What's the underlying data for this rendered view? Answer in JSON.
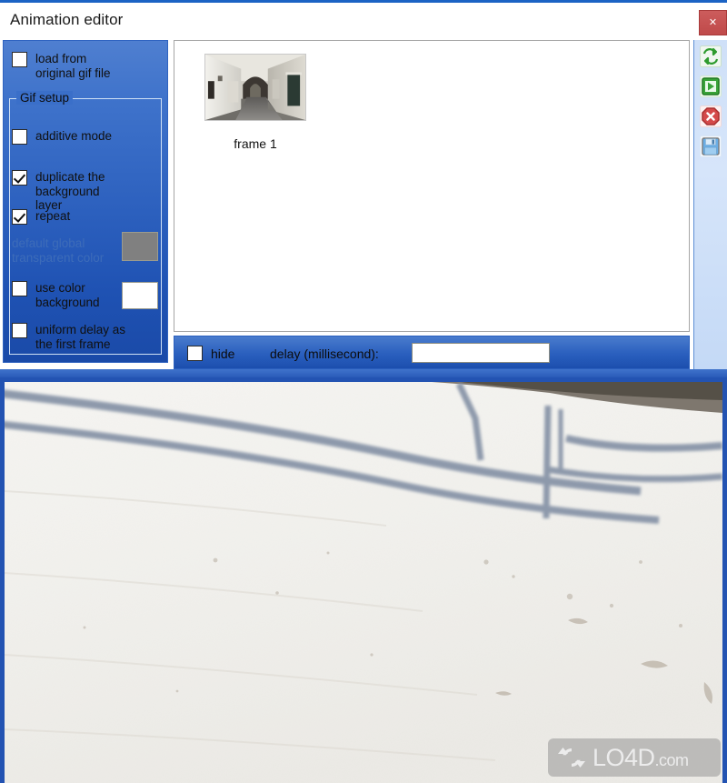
{
  "window": {
    "title": "Animation editor",
    "close_label": "✕"
  },
  "left_panel": {
    "load_from_original": {
      "label": "load from\noriginal gif file",
      "checked": false
    },
    "group": {
      "title": "Gif setup",
      "options": [
        {
          "name": "additive-mode",
          "label": "additive mode",
          "checked": false
        },
        {
          "name": "duplicate-background-layer",
          "label": "duplicate the\nbackground\nlayer",
          "checked": true
        },
        {
          "name": "repeat",
          "label": "repeat",
          "checked": true
        }
      ],
      "transparent_color": {
        "label": "default global\ntransparent color",
        "disabled": true,
        "swatch_color": "#808080"
      },
      "use_color_background": {
        "label": "use color\nbackground",
        "checked": false,
        "swatch_color": "#ffffff"
      },
      "uniform_delay": {
        "label": "uniform delay as\nthe first frame",
        "checked": false
      }
    }
  },
  "frames": {
    "items": [
      {
        "caption": "frame 1"
      }
    ]
  },
  "bottom_bar": {
    "hide": {
      "label": "hide",
      "checked": false
    },
    "delay": {
      "label": "delay (millisecond):",
      "value": "",
      "placeholder": ""
    }
  },
  "toolbar": {
    "buttons": [
      {
        "name": "refresh-icon",
        "title": "refresh",
        "color": "#3aa33a"
      },
      {
        "name": "play-icon",
        "title": "play",
        "color": "#3aa33a"
      },
      {
        "name": "stop-icon",
        "title": "stop",
        "color": "#cc3b3b"
      },
      {
        "name": "save-icon",
        "title": "save",
        "color": "#4a90d9"
      }
    ]
  },
  "watermark": {
    "text": "LO4D",
    "suffix": ".com"
  },
  "colors": {
    "panel_blue_top": "#4f7fd0",
    "panel_blue_bottom": "#1a4aa8",
    "accent": "#2353b2",
    "close_red": "#c65353",
    "toolbar_bg": "#d6e5fa"
  }
}
